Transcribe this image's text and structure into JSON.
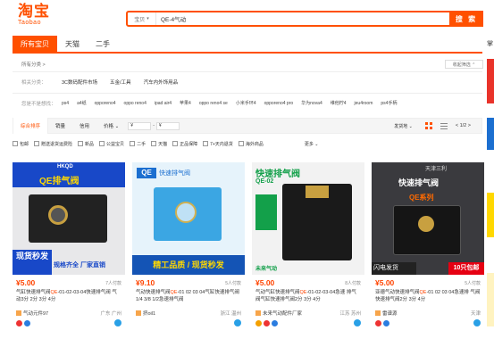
{
  "logo": {
    "cn": "淘宝",
    "en": "Taobao"
  },
  "search": {
    "type_label": "宝贝",
    "query": "QE-4气动",
    "button": "搜 索"
  },
  "tabs": [
    "所有宝贝",
    "天猫",
    "二手"
  ],
  "side_label": "掌",
  "crumb": "所有分类 >",
  "collapse_label": "收起筛选 ⌃",
  "filters": {
    "related_label": "相关分类：",
    "related": [
      "3C数码配件市场",
      "五金/工具",
      "汽车内外饰用品"
    ],
    "brand_label": "您是不是想找：",
    "brand": [
      "ps4",
      "a4纸",
      "opporeno4",
      "oppo reno4",
      "ipad air4",
      "苹果4",
      "oppo reno4 se",
      "小米手环4",
      "opporeno4 pro",
      "华为nova4",
      "维他柠4",
      "jeu4room",
      "ps4手柄"
    ]
  },
  "sortbar": {
    "items": [
      "综合排序",
      "销量",
      "信用",
      "价格 ⌄"
    ],
    "price_min": "¥",
    "price_max": "¥",
    "ship": "发货地 ⌄",
    "pager": "< 1/2 >"
  },
  "checks": [
    "包邮",
    "赠送退货运费险",
    "新品",
    "公益宝贝",
    "二手",
    "天猫",
    "正品保障",
    "7+天内退货",
    "海外商品"
  ],
  "more_label": "更多 ⌄",
  "products": [
    {
      "price": "¥5.00",
      "sold": "7人付款",
      "title_pre": "气缸快速排气阀",
      "title_hl": "QE",
      "title_post": "-01-02-03-04快速排气阀",
      "title2": "气动3分 2分 3分 4分",
      "shop": "气动元件97",
      "loc": "广东 广州"
    },
    {
      "price": "¥9.10",
      "sold": "5人付款",
      "title_pre": "气动快速排气阀",
      "title_hl": "QE",
      "title_post": "-01 02 03 04气缸快速排气阀",
      "title2": "1/4 3/8 1/2急速排气阀",
      "shop": "挤oil1",
      "loc": "浙江 温州"
    },
    {
      "price": "¥5.00",
      "sold": "8人付款",
      "title_pre": "气动气缸快速排气阀",
      "title_hl": "QE",
      "title_post": "-01-02-03-04急速",
      "title2": "排气阀气缸快速排气阀2分 3分 4分",
      "shop": "未来气动配件厂家",
      "loc": "江苏 苏州"
    },
    {
      "price": "¥5.00",
      "sold": "5人付款",
      "title_pre": "亚德气动快速排气阀",
      "title_hl": "QE",
      "title_post": "-01 02 03 04急速排",
      "title2": "气阀快速排气阀2分 3分 4分",
      "shop": "雷谱源",
      "loc": "天津"
    }
  ],
  "images": [
    {
      "brand": "QE排气阀",
      "sub": "规格齐全 厂家直销",
      "tag": "现货秒发",
      "code": "HKQD"
    },
    {
      "brand": "QE",
      "sub": "快速排气阀",
      "tag": "精工品质 / 现货秒发"
    },
    {
      "brand": "快速排气阀",
      "sub": "QE-02",
      "tag": "未来气动"
    },
    {
      "brand": "快速排气阀",
      "sub": "QE系列",
      "tag": "闪电发货",
      "tag2": "10只包邮",
      "top": "天津三利"
    }
  ],
  "colors": {
    "accent": "#ff5000",
    "price": "#ff4400"
  }
}
